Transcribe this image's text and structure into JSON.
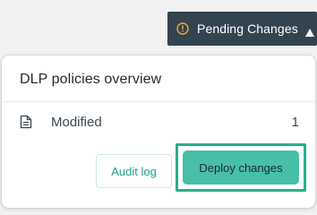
{
  "header": {
    "pending_button_label": "Pending Changes",
    "icons": {
      "status": "warning-circle-icon",
      "caret": "caret-up-icon"
    },
    "colors": {
      "button_bg": "#33444f",
      "warning": "#f0a53a"
    }
  },
  "panel": {
    "title": "DLP policies overview",
    "rows": [
      {
        "icon": "document-icon",
        "label": "Modified",
        "count": "1"
      }
    ],
    "actions": {
      "audit_label": "Audit log",
      "deploy_label": "Deploy changes"
    },
    "colors": {
      "accent": "#1e9f86",
      "deploy_bg": "#48bfa7",
      "focus_ring": "#2bae8e"
    }
  }
}
